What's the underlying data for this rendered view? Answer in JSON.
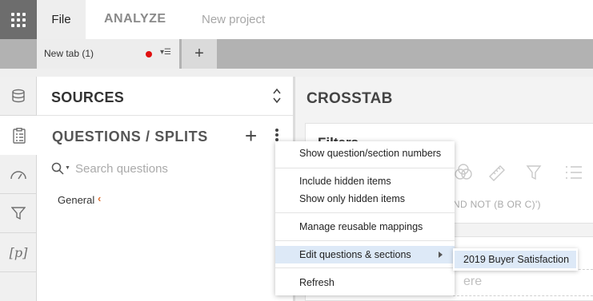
{
  "topbar": {
    "apps_icon": "grid-icon",
    "menu_file": "File",
    "menu_analyze": "ANALYZE",
    "project_name": "New project"
  },
  "tabs": {
    "items": [
      {
        "label": "New tab (1)",
        "unsaved_color": "#e01010"
      }
    ],
    "add_label": "+"
  },
  "rail": {
    "items": [
      {
        "name": "sources",
        "icon": "database-icon"
      },
      {
        "name": "questions",
        "icon": "checklist-icon",
        "active": true
      },
      {
        "name": "dashboard",
        "icon": "gauge-icon"
      },
      {
        "name": "filter",
        "icon": "filter-icon"
      },
      {
        "name": "parameters",
        "icon": "brackets-p-icon",
        "label": "[p]"
      }
    ]
  },
  "sources": {
    "title": "SOURCES",
    "toggle_icon": "chevron-up-down-icon"
  },
  "questions": {
    "title": "QUESTIONS / SPLITS",
    "add_label": "+",
    "more_icon": "vertical-dots-icon",
    "search": {
      "placeholder": "Search questions",
      "value": ""
    },
    "folders": [
      {
        "label": "General",
        "chevron": "‹"
      }
    ]
  },
  "crosstab": {
    "title": "CROSSTAB",
    "filters_title": "Filters",
    "filters_hint": "ND NOT (B OR C)')",
    "drop_hint": "ere"
  },
  "context_menu": {
    "items": [
      {
        "label": "Show question/section numbers"
      },
      {
        "label": "Include hidden items"
      },
      {
        "label": "Show only hidden items"
      },
      {
        "label": "Manage reusable mappings"
      },
      {
        "label": "Edit questions & sections",
        "highlighted": true,
        "has_submenu": true
      },
      {
        "label": "Refresh"
      }
    ],
    "submenu": [
      {
        "label": "2019 Buyer Satisfaction",
        "highlighted": true
      }
    ]
  },
  "colors": {
    "apps_button": "#6d6d6d",
    "tabstrip": "#b2b2b2",
    "menu_highlight": "#dde9f7",
    "chevron_accent": "#e07030"
  }
}
